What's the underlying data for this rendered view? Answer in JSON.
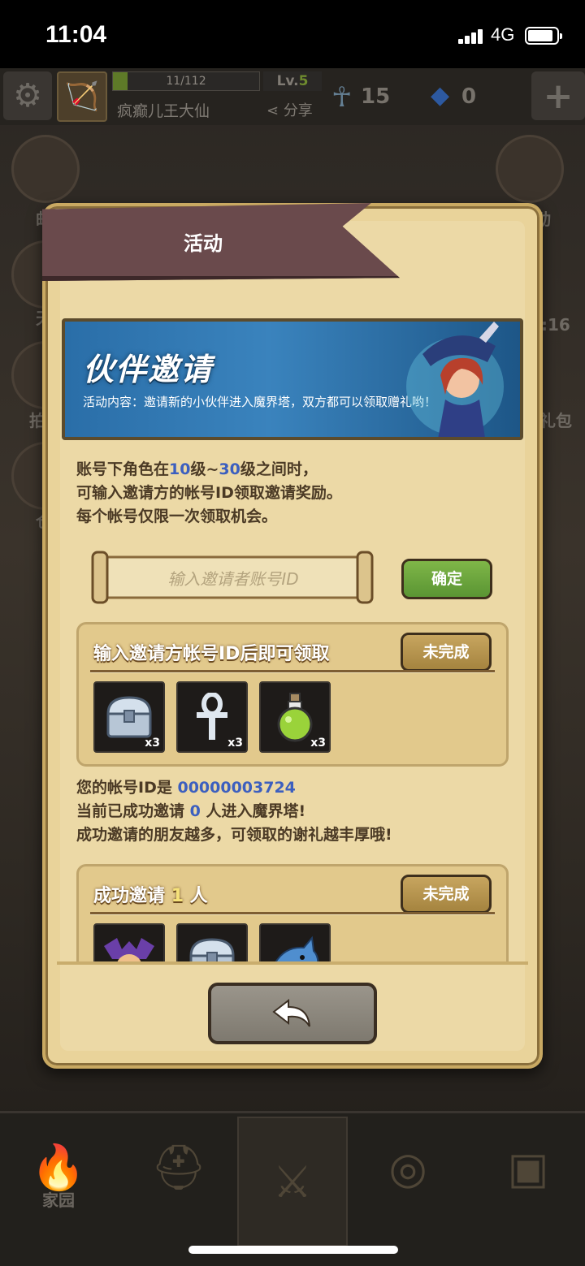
{
  "status_bar": {
    "time": "11:04",
    "network": "4G"
  },
  "top_bar": {
    "xp_text": "11/112",
    "xp_fraction": 0.098,
    "level_prefix": "Lv.",
    "level_number": "5",
    "player_name": "疯癫儿王大仙",
    "share_label": "分享",
    "ankh_count": "15",
    "gem_count": "0"
  },
  "side_labels": {
    "mail_partial": "邮",
    "activity": "活动",
    "day_partial": "天",
    "timer_partial": ":16",
    "auction_partial": "拍",
    "gift_partial": "礼包",
    "warehouse_partial": "仓"
  },
  "dialog": {
    "title": "活动",
    "banner": {
      "title": "伙伴邀请",
      "subtitle": "活动内容：邀请新的小伙伴进入魔界塔，双方都可以领取赠礼哟！"
    },
    "description": {
      "line1_pre": "账号下角色在",
      "level_min": "10",
      "line1_mid1": "级~",
      "level_max": "30",
      "line1_mid2": "级之间时，",
      "line2": "可输入邀请方的帐号ID领取邀请奖励。",
      "line3": "每个帐号仅限一次领取机会。"
    },
    "invite_input": {
      "placeholder": "输入邀请者账号ID",
      "value": ""
    },
    "confirm_label": "确定",
    "task1": {
      "title": "输入邀请方帐号ID后即可领取",
      "status": "未完成",
      "rewards": [
        {
          "icon": "silver-chest-icon",
          "count": "x3"
        },
        {
          "icon": "ankh-icon",
          "count": "x3"
        },
        {
          "icon": "green-potion-icon",
          "count": "x3"
        }
      ]
    },
    "account": {
      "id_label": "您的帐号ID是",
      "id_value": "00000003724",
      "invited_pre": "当前已成功邀请",
      "invited_count": "0",
      "invited_post": "人进入魔界塔!",
      "tip": "成功邀请的朋友越多，可领取的谢礼越丰厚哦!"
    },
    "task2": {
      "title_pre": "成功邀请",
      "title_count": "1",
      "title_post": "人",
      "status": "未完成",
      "rewards": [
        {
          "icon": "bat-hero-icon"
        },
        {
          "icon": "silver-chest-icon"
        },
        {
          "icon": "shark-pet-icon"
        }
      ]
    },
    "back_icon": "back-arrow-icon"
  },
  "bottom_nav": {
    "home_label": "家园"
  },
  "colors": {
    "highlight_blue": "#3c5fbf",
    "parchment": "#ecd9a6",
    "confirm_green": "#6aa53d",
    "status_gold": "#b8954e"
  }
}
